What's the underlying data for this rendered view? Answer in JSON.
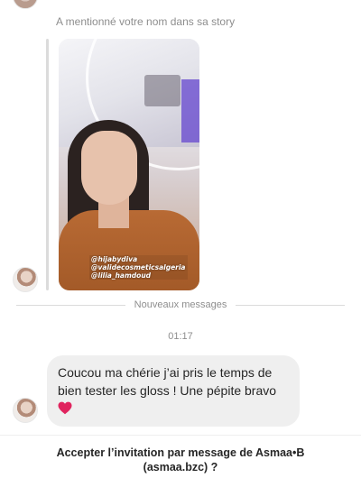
{
  "thread": {
    "mention_text": "A mentionné votre nom dans sa story",
    "story": {
      "tags": [
        "@hijabydiva",
        "@validecosmeticsalgeria",
        "@lilia_hamdoud"
      ]
    },
    "new_messages_label": "Nouveaux messages",
    "timestamp": "01:17",
    "message": {
      "text": "Coucou ma chérie j’ai pris le temps de bien tester les gloss ! Une pépite bravo",
      "emoji": "heart-icon"
    }
  },
  "invite": {
    "line1": "Accepter l’invitation par message de Asmaa•B",
    "line2": "(asmaa.bzc) ?"
  },
  "colors": {
    "heart": "#e0245e",
    "bubble": "#efefef",
    "meta_text": "#8e8e8e"
  }
}
